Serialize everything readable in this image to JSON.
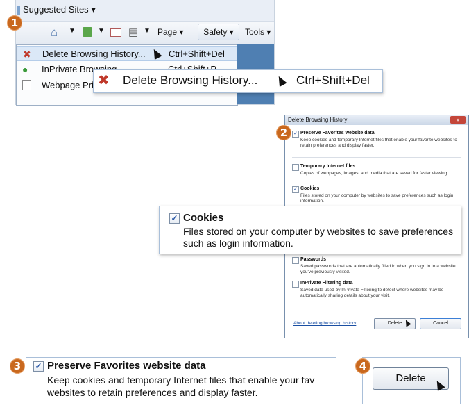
{
  "badges": {
    "b1": "1",
    "b2": "2",
    "b3": "3",
    "b4": "4"
  },
  "favorites_bar": {
    "suggested_sites": "Suggested Sites",
    "arrow": "▾"
  },
  "command_bar": {
    "page": "Page",
    "safety": "Safety",
    "tools": "Tools",
    "arrow": "▾"
  },
  "safety_menu": {
    "items": [
      {
        "label": "Delete Browsing History...",
        "shortcut": "Ctrl+Shift+Del"
      },
      {
        "label": "InPrivate Browsing",
        "shortcut": "Ctrl+Shift+P"
      },
      {
        "label": "Webpage Privacy Policy..."
      }
    ]
  },
  "callout1": {
    "label": "Delete Browsing History...",
    "shortcut": "Ctrl+Shift+Del"
  },
  "dialog": {
    "title": "Delete Browsing History",
    "close": "x",
    "options": [
      {
        "title": "Preserve Favorites website data",
        "desc": "Keep cookies and temporary Internet files that enable your favorite websites to retain preferences and display faster.",
        "checked": true
      },
      {
        "title": "Temporary Internet files",
        "desc": "Copies of webpages, images, and media that are saved for faster viewing.",
        "checked": false
      },
      {
        "title": "Cookies",
        "desc": "Files stored on your computer by websites to save preferences such as login information.",
        "checked": true
      },
      {
        "title": "Passwords",
        "desc": "Saved passwords that are automatically filled in when you sign in to a website you've previously visited.",
        "checked": false
      },
      {
        "title": "InPrivate Filtering data",
        "desc": "Saved data used by InPrivate Filtering to detect where websites may be automatically sharing details about your visit.",
        "checked": false
      }
    ],
    "link": "About deleting browsing history",
    "delete": "Delete",
    "cancel": "Cancel",
    "checkmark": "✓"
  },
  "callout2": {
    "title": "Cookies",
    "desc": "Files stored on your computer by websites to save preferences such as login information."
  },
  "callout3": {
    "title": "Preserve Favorites website data",
    "desc_line1": "Keep cookies and temporary Internet files that enable your fav",
    "desc_line2": "websites to retain preferences and display faster."
  },
  "callout4": {
    "delete": "Delete"
  },
  "colors": {
    "badge": "#c9681e",
    "link": "#1a4fa3",
    "menu_highlight": "#dbe8f7"
  }
}
